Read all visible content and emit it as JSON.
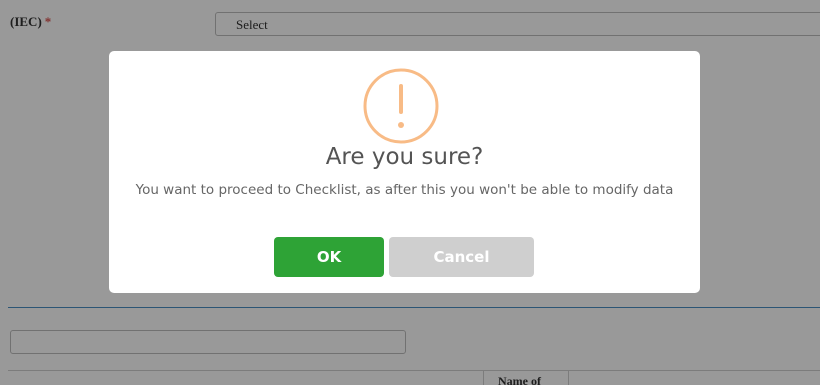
{
  "form": {
    "field_label": "(IEC)",
    "required_mark": "*",
    "select_value": "Select",
    "table_header_partial": "Name of"
  },
  "dialog": {
    "title": "Are you sure?",
    "message": "You want to proceed to Checklist, as after this you won't be able to modify data",
    "ok_label": "OK",
    "cancel_label": "Cancel",
    "icon": "warning-exclamation-icon"
  },
  "colors": {
    "ok_button": "#2ea336",
    "cancel_button": "#cfcfcf",
    "warning_icon": "#f8bb86",
    "overlay": "rgba(0,0,0,0.4)",
    "divider": "#4a8ec4"
  }
}
